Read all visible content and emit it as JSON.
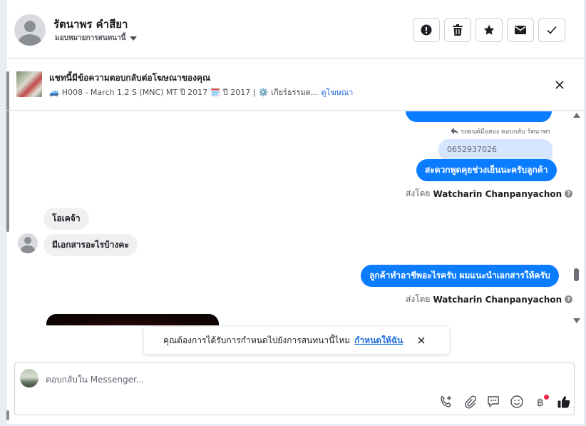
{
  "header": {
    "contact_name": "รัตนาพร คำสียา",
    "assign_label": "มอบหมายการสนทนานี้",
    "buttons": [
      {
        "name": "spam-button",
        "icon": "alert-icon"
      },
      {
        "name": "delete-button",
        "icon": "trash-icon"
      },
      {
        "name": "star-button",
        "icon": "star-icon"
      },
      {
        "name": "mark-unread-button",
        "icon": "envelope-icon"
      },
      {
        "name": "done-button",
        "icon": "check-icon"
      }
    ]
  },
  "ad": {
    "title": "แชทนี้มีข้อความตอบกลับต่อโฆษณาของคุณ",
    "car_emoji": "🚙",
    "model": "H008 - March 1.2 S (MNC) MT ปี 2017",
    "calendar_emoji": "🗓️",
    "year": "ปี 2017 |",
    "gear_emoji": "⚙️",
    "transmission": "เกียร์ธรรมด...",
    "view_ad_label": "ดูโฆษณา"
  },
  "messages": {
    "reply_note": "รถยนต์มือสอง ตอบกลับ รัตนาพร",
    "reply_quote": "0652937026",
    "out_1": "สะดวกพูดคุยช่วงเย็นนะครับลูกค้า",
    "sent_by_label": "ส่งโดย",
    "sent_by_name": "Watcharin Chanpanyachon",
    "in_1": "โอเคจ้า",
    "in_2": "มีเอกสารอะไรบ้างคะ",
    "out_2": "ลูกค้าทำอาชีพอะไรครับ ผมแนะนำเอกสารให้ครับ",
    "sent_by_label_2": "ส่งโดย",
    "sent_by_name_2": "Watcharin Chanpanyachon"
  },
  "toast": {
    "text": "คุณต้องการได้รับการกำหนดไปยังการสนทนานี้ไหม",
    "link": "กำหนดให้ฉัน"
  },
  "composer": {
    "placeholder": "ตอบกลับใน Messenger...",
    "icons": [
      "phone-add-icon",
      "attachment-icon",
      "saved-reply-icon",
      "emoji-icon",
      "baht-icon",
      "thumbs-up-icon"
    ]
  },
  "colors": {
    "accent": "#0a7cff",
    "link": "#216fdb",
    "incoming_bg": "#eef0f2",
    "reply_bg": "#d6e6ff"
  }
}
